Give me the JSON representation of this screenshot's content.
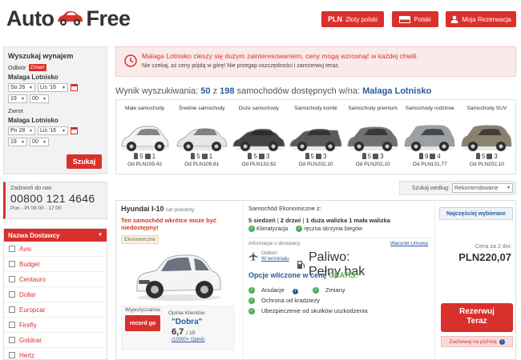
{
  "header": {
    "logo_left": "Auto",
    "logo_right": "Free",
    "currency_code": "PLN",
    "currency_name": "Złoty polski",
    "language": "Polski",
    "my_booking": "Moja Rezerwacja"
  },
  "search": {
    "title": "Wyszukaj wynajem",
    "pickup_label": "Odbiór",
    "change_label": "Zmień",
    "pickup_location": "Malaga Lotnisko",
    "pickup_day": "So 26",
    "pickup_month": "Lis '16",
    "pickup_hour": "19",
    "pickup_min": "00",
    "return_label": "Zwrot",
    "return_location": "Malaga Lotnisko",
    "return_day": "Pn 28",
    "return_month": "Lis '16",
    "return_hour": "19",
    "return_min": "00",
    "button": "Szukaj"
  },
  "phone": {
    "label": "Zadzwoń do nas",
    "number": "00800 121 4646",
    "hours": "Pon - Pt 09:00 - 17:00"
  },
  "suppliers": {
    "header": "Nazwa Dostawcy",
    "items": [
      "Avis",
      "Budget",
      "Centauro",
      "Dollar",
      "Europcar",
      "Firefly",
      "Goldcar",
      "Hertz"
    ]
  },
  "alert": {
    "line1": "Malaga Lotnisko cieszy się dużym zainteresowaniem, ceny mogą wzrosnąć w każdej chwili.",
    "line2": "Nie czekaj, aż ceny pójdą w górę! Nie przegap oszczędności i zarezerwuj teraz."
  },
  "results": {
    "prefix": "Wynik wyszukiwania:",
    "shown": "50",
    "of": "z",
    "total": "198",
    "suffix": "samochodów dostępnych w/na:",
    "location": "Malaga Lotnisko"
  },
  "categories": [
    {
      "name": "Małe samochody",
      "seats": "5",
      "bags": "1",
      "price": "Od PLN109,42"
    },
    {
      "name": "Średnie samochody",
      "seats": "5",
      "bags": "1",
      "price": "Od PLN109,81"
    },
    {
      "name": "Duże samochody",
      "seats": "5",
      "bags": "3",
      "price": "Od PLN132,62"
    },
    {
      "name": "Samochody kombi",
      "seats": "5",
      "bags": "3",
      "price": "Od PLN202,10"
    },
    {
      "name": "Samochody premium",
      "seats": "5",
      "bags": "3",
      "price": "Od PLN202,10"
    },
    {
      "name": "Samochody rodzinne",
      "seats": "9",
      "bags": "4",
      "price": "Od PLN131,77"
    },
    {
      "name": "Samochody SUV",
      "seats": "5",
      "bags": "3",
      "price": "Od PLN202,10"
    }
  ],
  "sort": {
    "label": "Szukaj według:",
    "value": "Rekomendowane"
  },
  "car": {
    "title": "Hyundai I-10",
    "or_similar": "lub podobny",
    "warning": "Ten samochód wkrótce może być niedostępny!",
    "category": "Ekonomiczne",
    "supplier_label": "Wypożyczalnia:",
    "supplier_logo": "record go",
    "rating_label": "Opinia Klientów:",
    "rating_word": "\"Dobra\"",
    "score": "6,7",
    "score_of": "/ 10",
    "reviews": "(10000+ Opinii)",
    "class": "Samochód Ekonomiczne z:",
    "seats": "5 siedzeń",
    "doors": "2 drzwi",
    "luggage": "1 duża walizka 1 mała walizka",
    "feature1": "Klimatyzacja",
    "feature2": "ręczna skrzynia biegów",
    "supplier_info": "Informacje o dostawcy",
    "terms": "Warunki Umowy",
    "pickup_k": "Odbiór:",
    "pickup_v": "W terminalu",
    "fuel_k": "Paliwo:",
    "fuel_v": "Pełny bak",
    "included_a": "Opcje wliczone w cenę",
    "included_b": "GRATIS:",
    "opt1": "Anulacje",
    "opt2": "Zmiany",
    "opt3": "Ochrona od kradzieży",
    "opt4": "Ubezpieczenie od skutków uszkodzenia",
    "best": "Najczęściej wybierane",
    "price_label": "Cena za 2 dni:",
    "price": "PLN220,07",
    "book_line1": "Rezerwuj",
    "book_line2": "Teraz",
    "later": "Zachowaj na później"
  },
  "colors": {
    "accent": "#d9302c",
    "link": "#2a5aa0",
    "ok": "#4caf50"
  }
}
